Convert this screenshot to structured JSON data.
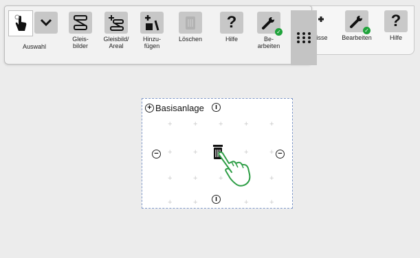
{
  "back_toolbar": {
    "buttons": [
      {
        "label": "nisse",
        "icon": "hidden-partial-icon"
      },
      {
        "label": "Bearbeiten",
        "icon": "wrench-check-icon"
      },
      {
        "label": "Hilfe",
        "icon": "question-icon"
      }
    ]
  },
  "toolbar": {
    "selector_label": "Auswahl",
    "tools": [
      {
        "label": "Gleis-\nbilder",
        "icon": "track-diagram-icon"
      },
      {
        "label": "Gleisbild/\nAreal",
        "icon": "track-area-icon"
      },
      {
        "label": "Hinzu-\nfügen",
        "icon": "add-icon"
      },
      {
        "label": "Löschen",
        "icon": "trash-icon",
        "disabled": true
      },
      {
        "label": "Hilfe",
        "icon": "question-icon"
      },
      {
        "label": "Be-\narbeiten",
        "icon": "wrench-check-icon"
      }
    ]
  },
  "canvas": {
    "title": "Basisanlage"
  },
  "colors": {
    "accent_check": "#1fa33b",
    "canvas_border": "#7f98c9",
    "hand_pointer": "#2e9e46"
  }
}
